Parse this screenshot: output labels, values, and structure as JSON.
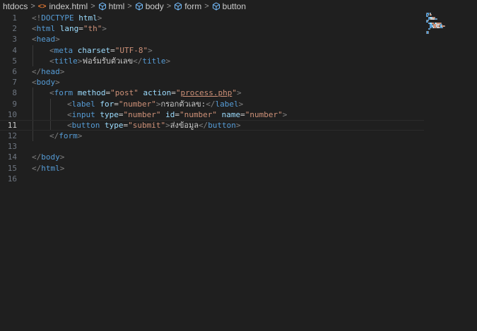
{
  "breadcrumb": [
    {
      "label": "htdocs",
      "icon": ""
    },
    {
      "label": "index.html",
      "icon": "html-file-icon"
    },
    {
      "label": "html",
      "icon": "element-cube-icon"
    },
    {
      "label": "body",
      "icon": "element-cube-icon"
    },
    {
      "label": "form",
      "icon": "element-cube-icon"
    },
    {
      "label": "button",
      "icon": "element-cube-icon"
    }
  ],
  "html_icon_glyph": "<>",
  "separator_glyph": ">",
  "colors": {
    "background": "#1f1f1f",
    "tag": "#569cd6",
    "attribute": "#9cdcfe",
    "string": "#ce9178",
    "bracket": "#808080",
    "text": "#cccccc",
    "line_number": "#6e7681"
  },
  "editor": {
    "active_line": 11,
    "lines": [
      {
        "n": "1",
        "indent": 0,
        "t": [
          [
            "b",
            "<!"
          ],
          [
            "t",
            "DOCTYPE"
          ],
          [
            "x",
            " "
          ],
          [
            "a",
            "html"
          ],
          [
            "b",
            ">"
          ]
        ]
      },
      {
        "n": "2",
        "indent": 0,
        "t": [
          [
            "b",
            "<"
          ],
          [
            "t",
            "html"
          ],
          [
            "x",
            " "
          ],
          [
            "a",
            "lang"
          ],
          [
            "e",
            "="
          ],
          [
            "s",
            "\"th\""
          ],
          [
            "b",
            ">"
          ]
        ]
      },
      {
        "n": "3",
        "indent": 0,
        "t": [
          [
            "b",
            "<"
          ],
          [
            "t",
            "head"
          ],
          [
            "b",
            ">"
          ]
        ]
      },
      {
        "n": "4",
        "indent": 1,
        "t": [
          [
            "b",
            "<"
          ],
          [
            "t",
            "meta"
          ],
          [
            "x",
            " "
          ],
          [
            "a",
            "charset"
          ],
          [
            "e",
            "="
          ],
          [
            "s",
            "\"UTF-8\""
          ],
          [
            "b",
            ">"
          ]
        ]
      },
      {
        "n": "5",
        "indent": 1,
        "t": [
          [
            "b",
            "<"
          ],
          [
            "t",
            "title"
          ],
          [
            "b",
            ">"
          ],
          [
            "x",
            "ฟอร์มรับตัวเลข"
          ],
          [
            "b",
            "</"
          ],
          [
            "t",
            "title"
          ],
          [
            "b",
            ">"
          ]
        ]
      },
      {
        "n": "6",
        "indent": 0,
        "t": [
          [
            "b",
            "</"
          ],
          [
            "t",
            "head"
          ],
          [
            "b",
            ">"
          ]
        ]
      },
      {
        "n": "7",
        "indent": 0,
        "t": [
          [
            "b",
            "<"
          ],
          [
            "t",
            "body"
          ],
          [
            "b",
            ">"
          ]
        ]
      },
      {
        "n": "8",
        "indent": 1,
        "t": [
          [
            "b",
            "<"
          ],
          [
            "t",
            "form"
          ],
          [
            "x",
            " "
          ],
          [
            "a",
            "method"
          ],
          [
            "e",
            "="
          ],
          [
            "s",
            "\"post\""
          ],
          [
            "x",
            " "
          ],
          [
            "a",
            "action"
          ],
          [
            "e",
            "="
          ],
          [
            "s",
            "\""
          ],
          [
            "u",
            "process.php"
          ],
          [
            "s",
            "\""
          ],
          [
            "b",
            ">"
          ]
        ]
      },
      {
        "n": "9",
        "indent": 2,
        "t": [
          [
            "b",
            "<"
          ],
          [
            "t",
            "label"
          ],
          [
            "x",
            " "
          ],
          [
            "a",
            "for"
          ],
          [
            "e",
            "="
          ],
          [
            "s",
            "\"number\""
          ],
          [
            "b",
            ">"
          ],
          [
            "x",
            "กรอกตัวเลข:"
          ],
          [
            "b",
            "</"
          ],
          [
            "t",
            "label"
          ],
          [
            "b",
            ">"
          ]
        ]
      },
      {
        "n": "10",
        "indent": 2,
        "t": [
          [
            "b",
            "<"
          ],
          [
            "t",
            "input"
          ],
          [
            "x",
            " "
          ],
          [
            "a",
            "type"
          ],
          [
            "e",
            "="
          ],
          [
            "s",
            "\"number\""
          ],
          [
            "x",
            " "
          ],
          [
            "a",
            "id"
          ],
          [
            "e",
            "="
          ],
          [
            "s",
            "\"number\""
          ],
          [
            "x",
            " "
          ],
          [
            "a",
            "name"
          ],
          [
            "e",
            "="
          ],
          [
            "s",
            "\"number\""
          ],
          [
            "b",
            ">"
          ]
        ]
      },
      {
        "n": "11",
        "indent": 2,
        "t": [
          [
            "b",
            "<"
          ],
          [
            "t",
            "button"
          ],
          [
            "x",
            " "
          ],
          [
            "a",
            "type"
          ],
          [
            "e",
            "="
          ],
          [
            "s",
            "\"submit\""
          ],
          [
            "b",
            ">"
          ],
          [
            "x",
            "ส่งข้อมูล"
          ],
          [
            "b",
            "</"
          ],
          [
            "t",
            "button"
          ],
          [
            "b",
            ">"
          ]
        ]
      },
      {
        "n": "12",
        "indent": 1,
        "t": [
          [
            "b",
            "</"
          ],
          [
            "t",
            "form"
          ],
          [
            "b",
            ">"
          ]
        ]
      },
      {
        "n": "13",
        "indent": 0,
        "t": []
      },
      {
        "n": "14",
        "indent": 0,
        "t": [
          [
            "b",
            "</"
          ],
          [
            "t",
            "body"
          ],
          [
            "b",
            ">"
          ]
        ]
      },
      {
        "n": "15",
        "indent": 0,
        "t": [
          [
            "b",
            "</"
          ],
          [
            "t",
            "html"
          ],
          [
            "b",
            ">"
          ]
        ]
      },
      {
        "n": "16",
        "indent": 0,
        "t": []
      }
    ]
  }
}
